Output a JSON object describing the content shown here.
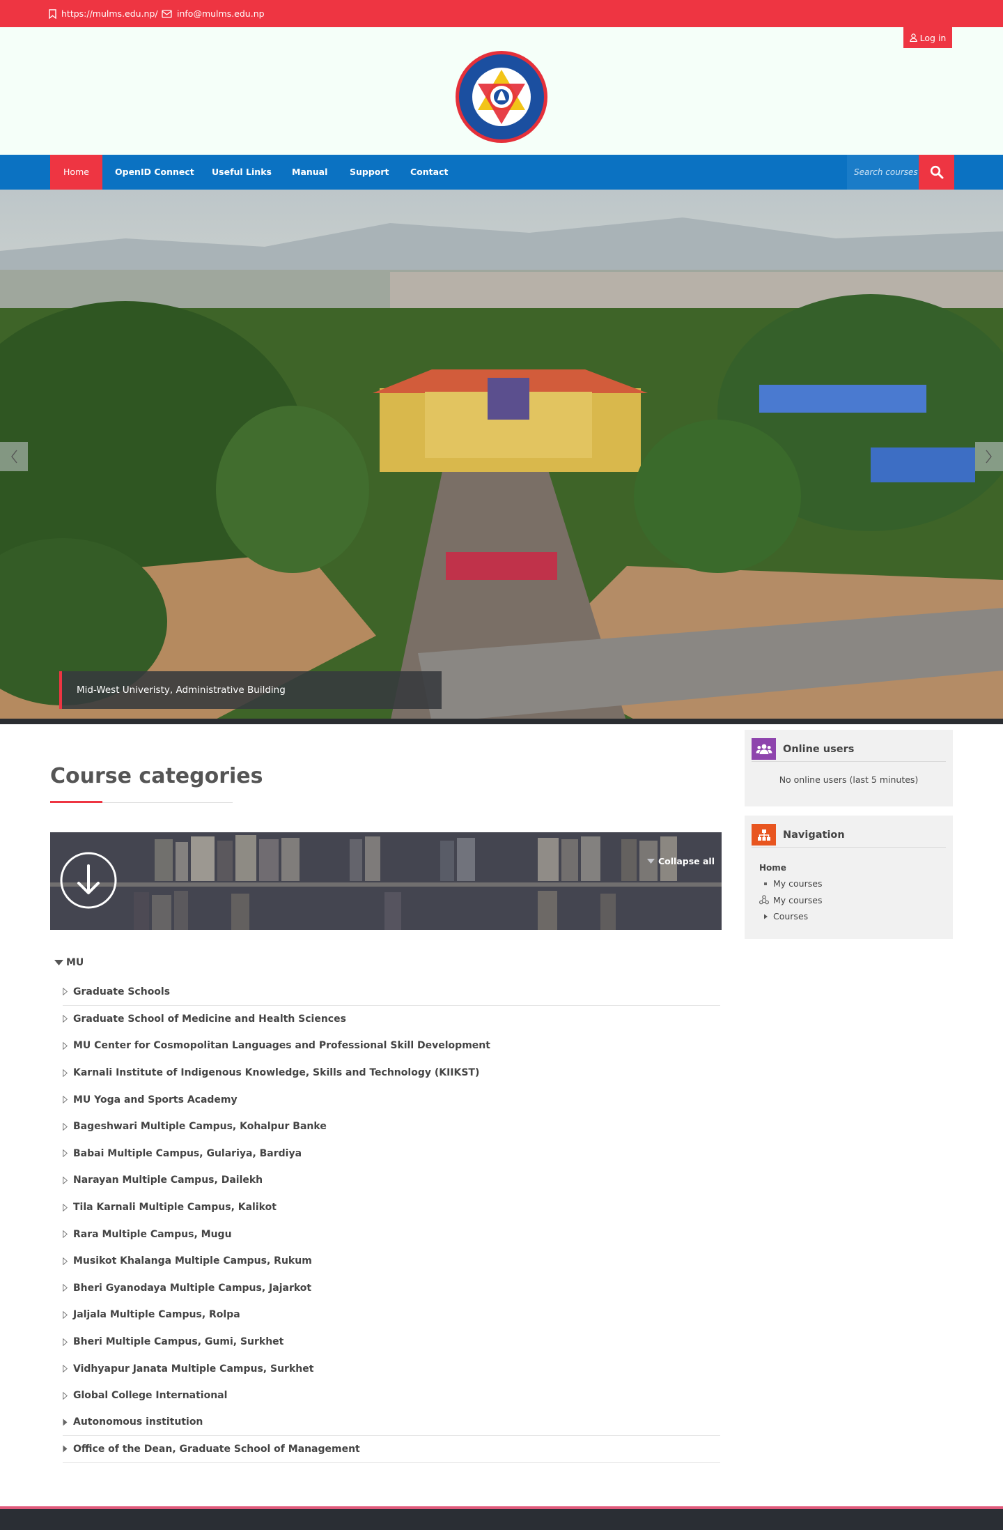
{
  "topbar": {
    "url": "https://mulms.edu.np/",
    "email": "info@mulms.edu.np"
  },
  "header": {
    "login_label": "Log in"
  },
  "nav": {
    "items": [
      "Home",
      "OpenID Connect",
      "Useful Links",
      "Manual",
      "Support",
      "Contact"
    ],
    "search_placeholder": "Search courses"
  },
  "hero": {
    "caption": "Mid-West Univeristy, Administrative Building"
  },
  "main": {
    "title": "Course categories",
    "collapse_label": "Collapse all",
    "root_category": "MU",
    "categories": [
      "Graduate Schools",
      "Graduate School of Medicine and Health Sciences",
      "MU Center for Cosmopolitan Languages and Professional Skill Development",
      "Karnali Institute of Indigenous Knowledge, Skills and Technology (KIIKST)",
      "MU Yoga and Sports Academy",
      "Bageshwari Multiple Campus, Kohalpur Banke",
      "Babai Multiple Campus, Gulariya, Bardiya",
      "Narayan Multiple Campus, Dailekh",
      "Tila Karnali Multiple Campus, Kalikot",
      "Rara Multiple Campus, Mugu",
      "Musikot Khalanga Multiple Campus, Rukum",
      "Bheri Gyanodaya Multiple Campus, Jajarkot",
      "Jaljala Multiple Campus, Rolpa",
      "Bheri Multiple Campus, Gumi, Surkhet",
      "Vidhyapur Janata Multiple Campus, Surkhet",
      "Global College International",
      "Autonomous institution",
      "Office of the Dean, Graduate School of Management"
    ]
  },
  "blocks": {
    "online_users": {
      "title": "Online users",
      "empty_text": "No online users (last 5 minutes)",
      "icon": "users-icon",
      "color": "#8e44ad"
    },
    "navigation": {
      "title": "Navigation",
      "icon": "sitemap-icon",
      "color": "#e8551f",
      "home": "Home",
      "items": [
        "My courses",
        "My courses",
        "Courses"
      ]
    }
  },
  "colors": {
    "brand_red": "#ee3542",
    "nav_blue": "#0b72c2",
    "header_bg": "#f5fff9"
  }
}
